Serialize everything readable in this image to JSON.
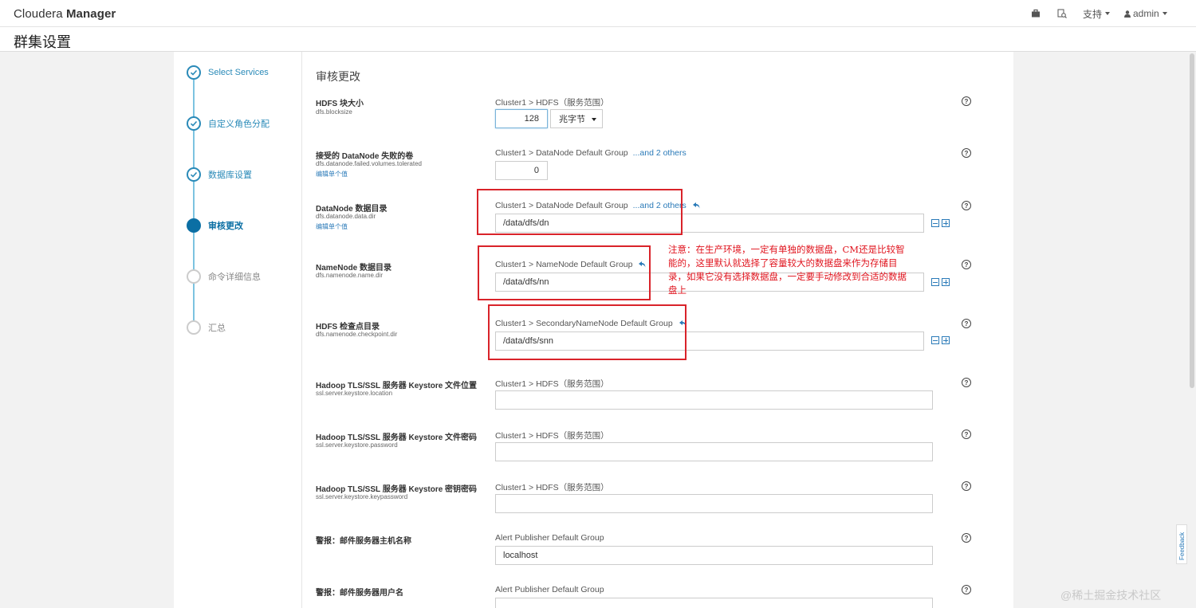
{
  "app": {
    "brand_light": "Cloudera ",
    "brand_bold": "Manager"
  },
  "nav": {
    "support": "支持",
    "user": "admin"
  },
  "page_title": "群集设置",
  "steps": [
    {
      "label": "Select Services",
      "state": "done"
    },
    {
      "label": "自定义角色分配",
      "state": "done"
    },
    {
      "label": "数据库设置",
      "state": "done"
    },
    {
      "label": "审核更改",
      "state": "active"
    },
    {
      "label": "命令详细信息",
      "state": "todo"
    },
    {
      "label": "汇总",
      "state": "todo"
    }
  ],
  "section_title": "审核更改",
  "props": {
    "blocksize": {
      "name": "HDFS 块大小",
      "key": "dfs.blocksize",
      "scope": "Cluster1 > HDFS（服务范围）",
      "value": "128",
      "unit": "兆字节"
    },
    "failed_volumes": {
      "name": "接受的 DataNode 失败的卷",
      "key": "dfs.datanode.failed.volumes.tolerated",
      "edit": "编辑单个值",
      "scope": "Cluster1 > DataNode Default Group",
      "others": "...and 2 others",
      "value": "0"
    },
    "dn_dir": {
      "name": "DataNode 数据目录",
      "key": "dfs.datanode.data.dir",
      "edit": "编辑单个值",
      "scope": "Cluster1 > DataNode Default Group",
      "others": "...and 2 others",
      "value": "/data/dfs/dn"
    },
    "nn_dir": {
      "name": "NameNode 数据目录",
      "key": "dfs.namenode.name.dir",
      "scope": "Cluster1 > NameNode Default Group",
      "value": "/data/dfs/nn"
    },
    "checkpoint_dir": {
      "name": "HDFS 检查点目录",
      "key": "dfs.namenode.checkpoint.dir",
      "scope": "Cluster1 > SecondaryNameNode Default Group",
      "value": "/data/dfs/snn"
    },
    "keystore_location": {
      "name": "Hadoop TLS/SSL 服务器 Keystore 文件位置",
      "key": "ssl.server.keystore.location",
      "scope": "Cluster1 > HDFS（服务范围）",
      "value": ""
    },
    "keystore_password": {
      "name": "Hadoop TLS/SSL 服务器 Keystore 文件密码",
      "key": "ssl.server.keystore.password",
      "scope": "Cluster1 > HDFS（服务范围）",
      "value": ""
    },
    "keystore_keypassword": {
      "name": "Hadoop TLS/SSL 服务器 Keystore 密钥密码",
      "key": "ssl.server.keystore.keypassword",
      "scope": "Cluster1 > HDFS（服务范围）",
      "value": ""
    },
    "mail_host": {
      "name": "警报：邮件服务器主机名称",
      "scope": "Alert Publisher Default Group",
      "value": "localhost"
    },
    "mail_user": {
      "name": "警报：邮件服务器用户名",
      "scope": "Alert Publisher Default Group",
      "value": ""
    }
  },
  "help_glyph": "?",
  "annotation": "注意：在生产环境，一定有单独的数据盘，CM还是比较智能的，这里默认就选择了容量较大的数据盘来作为存储目录，如果它没有选择数据盘，一定要手动修改到合适的数据盘上",
  "feedback": "Feedback",
  "watermark": "@稀土掘金技术社区",
  "colors": {
    "accent": "#0b6fa4",
    "link": "#2a7ab8",
    "annotation": "#d9232a"
  }
}
